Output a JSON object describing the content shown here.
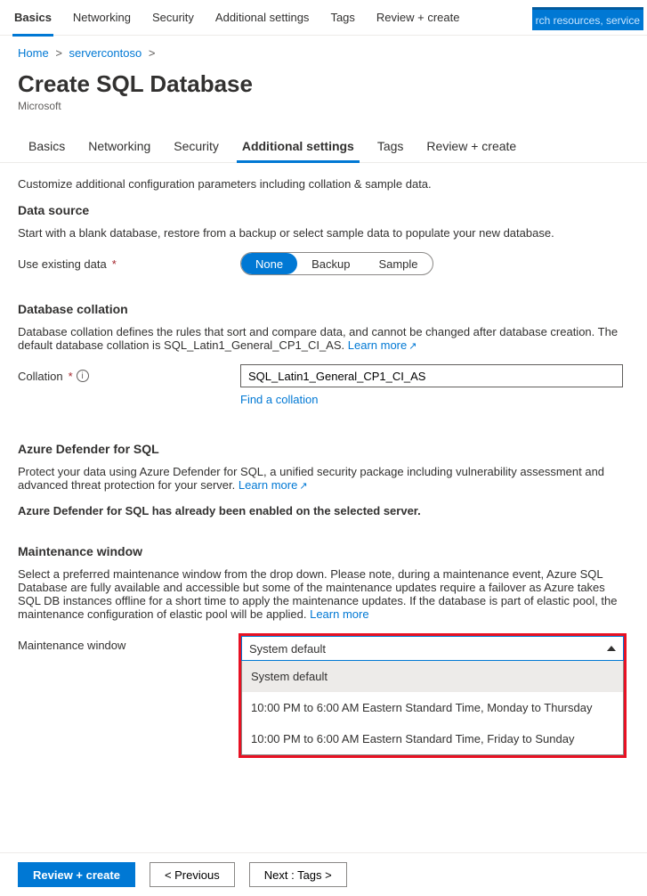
{
  "search_fragment": "rch resources, service",
  "top_tabs": {
    "items": [
      "Basics",
      "Networking",
      "Security",
      "Additional settings",
      "Tags",
      "Review + create"
    ],
    "active_index": 0
  },
  "breadcrumb": {
    "items": [
      "Home",
      "servercontoso"
    ],
    "seps": [
      ">",
      ">"
    ]
  },
  "header": {
    "title": "Create SQL Database",
    "subtitle": "Microsoft"
  },
  "inner_tabs": {
    "items": [
      "Basics",
      "Networking",
      "Security",
      "Additional settings",
      "Tags",
      "Review + create"
    ],
    "active_index": 3
  },
  "intro": "Customize additional configuration parameters including collation & sample data.",
  "data_source": {
    "heading": "Data source",
    "desc": "Start with a blank database, restore from a backup or select sample data to populate your new database.",
    "label": "Use existing data",
    "options": [
      "None",
      "Backup",
      "Sample"
    ],
    "selected_index": 0
  },
  "collation": {
    "heading": "Database collation",
    "desc_prefix": "Database collation defines the rules that sort and compare data, and cannot be changed after database creation. The default database collation is SQL_Latin1_General_CP1_CI_AS. ",
    "learn_more": "Learn more",
    "label": "Collation",
    "value": "SQL_Latin1_General_CP1_CI_AS",
    "find_link": "Find a collation"
  },
  "defender": {
    "heading": "Azure Defender for SQL",
    "desc_prefix": "Protect your data using Azure Defender for SQL, a unified security package including vulnerability assessment and advanced threat protection for your server. ",
    "learn_more": "Learn more",
    "note": "Azure Defender for SQL has already been enabled on the selected server."
  },
  "maintenance": {
    "heading": "Maintenance window",
    "desc_prefix": "Select a preferred maintenance window from the drop down. Please note, during a maintenance event, Azure SQL Database are fully available and accessible but some of the maintenance updates require a failover as Azure takes SQL DB instances offline for a short time to apply the maintenance updates. If the database is part of elastic pool, the maintenance configuration of elastic pool will be applied. ",
    "learn_more": "Learn more",
    "label": "Maintenance window",
    "selected": "System default",
    "options": [
      "System default",
      "10:00 PM to 6:00 AM Eastern Standard Time, Monday to Thursday",
      "10:00 PM to 6:00 AM Eastern Standard Time, Friday to Sunday"
    ]
  },
  "footer": {
    "review": "Review + create",
    "previous": "< Previous",
    "next": "Next : Tags >"
  }
}
